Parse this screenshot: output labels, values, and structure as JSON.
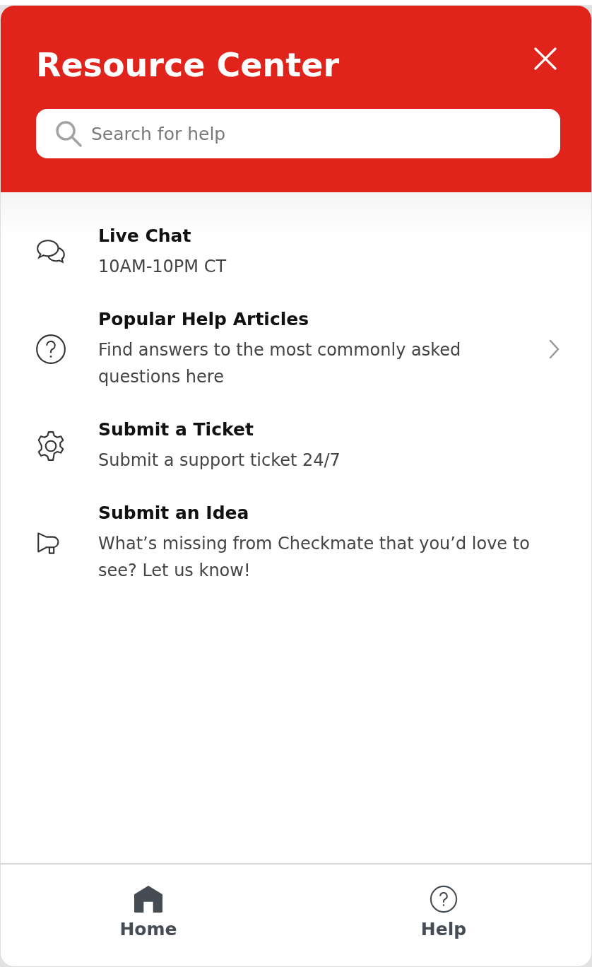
{
  "header": {
    "title": "Resource Center",
    "search": {
      "placeholder": "Search for help"
    }
  },
  "items": [
    {
      "title": "Live Chat",
      "subtitle": "10AM-10PM CT",
      "chevron": false
    },
    {
      "title": "Popular Help Articles",
      "subtitle": "Find answers to the most commonly asked questions here",
      "chevron": true
    },
    {
      "title": "Submit a Ticket",
      "subtitle": "Submit a support ticket 24/7",
      "chevron": false
    },
    {
      "title": "Submit an Idea",
      "subtitle": "What’s missing from Checkmate that you’d love to see? Let us know!",
      "chevron": false
    }
  ],
  "nav": [
    {
      "label": "Home"
    },
    {
      "label": "Help"
    }
  ]
}
